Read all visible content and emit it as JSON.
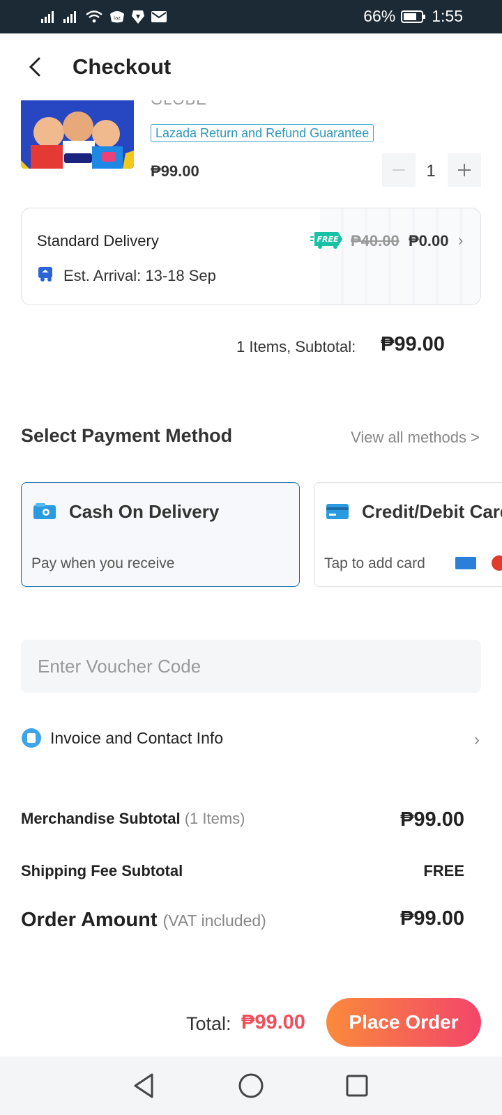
{
  "status_bar": {
    "battery_percent": "66%",
    "time": "1:55",
    "icons": [
      "signal-icon",
      "signal-icon",
      "wifi-icon",
      "lazada-app-icon",
      "brave-icon",
      "mail-icon",
      "battery-icon"
    ]
  },
  "header": {
    "title": "Checkout",
    "back_icon": "chevron-left-icon"
  },
  "product": {
    "brand": "GLOBE",
    "guarantee": "Lazada Return and Refund Guarantee",
    "price": "₱99.00",
    "quantity": "1",
    "minus_icon": "minus-icon",
    "plus_icon": "plus-icon"
  },
  "delivery": {
    "title": "Standard Delivery",
    "free_badge": "FREE",
    "original_fee": "₱40.00",
    "fee": "₱0.00",
    "arrival": "Est. Arrival: 13-18 Sep"
  },
  "subtotal": {
    "label": "1 Items, Subtotal:",
    "value": "₱99.00"
  },
  "payment": {
    "heading": "Select Payment Method",
    "view_all": "View all methods >",
    "methods": [
      {
        "title": "Cash On Delivery",
        "subtitle": "Pay when you receive",
        "icon": "cash-icon",
        "selected": true
      },
      {
        "title": "Credit/Debit Card",
        "subtitle": "Tap to add card",
        "icon": "credit-card-icon",
        "selected": false
      }
    ]
  },
  "voucher": {
    "placeholder": "Enter Voucher Code"
  },
  "invoice": {
    "label": "Invoice and Contact Info"
  },
  "summary": {
    "merch_label": "Merchandise Subtotal",
    "merch_count": "(1 Items)",
    "merch_value": "₱99.00",
    "shipping_label": "Shipping Fee Subtotal",
    "shipping_value": "FREE",
    "order_label": "Order Amount",
    "order_note": "(VAT included)",
    "order_value": "₱99.00"
  },
  "footer": {
    "total_label": "Total:",
    "total_value": "₱99.00",
    "place_order": "Place Order"
  },
  "colors": {
    "accent_teal": "#3aa6c7",
    "selected_border": "#1a6da6",
    "price_red": "#f0505d",
    "button_gradient_start": "#fa8a3b",
    "button_gradient_end": "#f3456a",
    "status_bar_bg": "#1c2a36"
  }
}
